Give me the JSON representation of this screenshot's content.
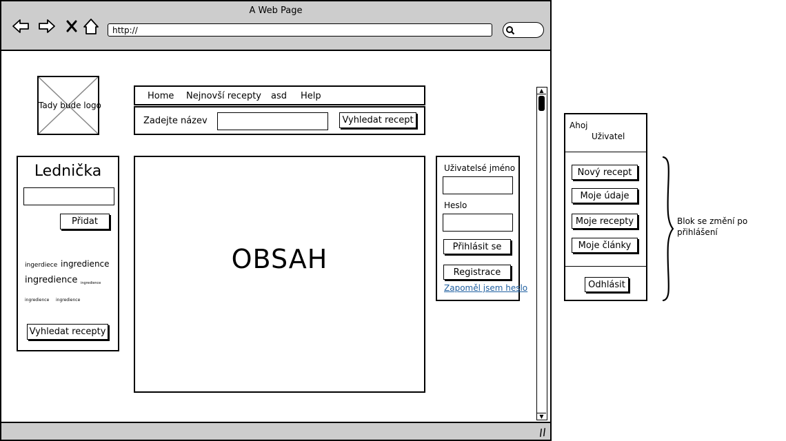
{
  "window": {
    "title": "A Web Page",
    "url": "http://"
  },
  "logo": {
    "label": "Tady bude logo"
  },
  "nav": {
    "items": [
      "Home",
      "Nejnovší recepty",
      "asd",
      "Help"
    ]
  },
  "search": {
    "label": "Zadejte název",
    "button": "Vyhledat recept"
  },
  "fridge": {
    "title": "Lednička",
    "add_button": "Přidat",
    "tags": [
      "ingerdiece",
      "ingredience",
      "ingredience",
      "ingredience",
      "ingredience",
      "ingredience"
    ],
    "search_button": "Vyhledat recepty"
  },
  "content": {
    "label": "OBSAH"
  },
  "login": {
    "username_label": "Uživatelsé jméno",
    "password_label": "Heslo",
    "login_button": "Přihlásit se",
    "register_button": "Registrace",
    "forgot_link": "Zapoměl jsem heslo"
  },
  "user_panel": {
    "greeting": "Ahoj",
    "username": "Uživatel",
    "buttons": [
      "Nový recept",
      "Moje údaje",
      "Moje recepty",
      "Moje články"
    ],
    "logout": "Odhlásit"
  },
  "annotation": {
    "note": "Blok se změní po přihlášení"
  }
}
